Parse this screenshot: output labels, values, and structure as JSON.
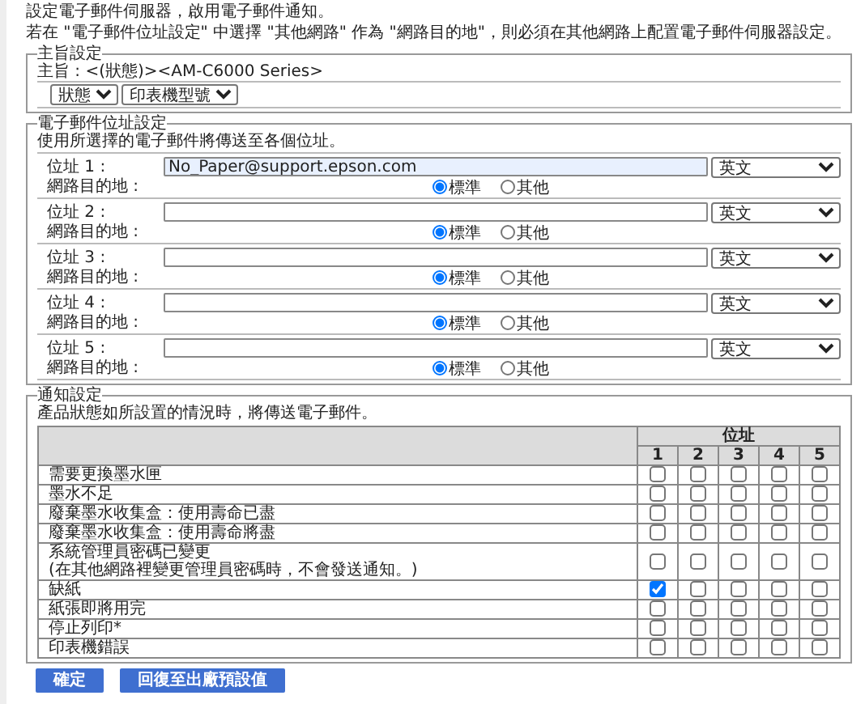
{
  "intro": [
    "設定電子郵件伺服器，啟用電子郵件通知。",
    "若在 \"電子郵件位址設定\" 中選擇 \"其他網路\" 作為 \"網路目的地\"，則必須在其他網路上配置電子郵件伺服器設定。"
  ],
  "subject_settings": {
    "title": "主旨設定",
    "subject": "主旨 : <(狀態)><AM-C6000 Series>",
    "selects": [
      "狀態",
      "印表機型號"
    ]
  },
  "address_settings": {
    "title": "電子郵件位址設定",
    "description": "使用所選擇的電子郵件將傳送至各個位址。",
    "addresses": [
      {
        "label": "位址 1 :",
        "value": "No_Paper@support.epson.com",
        "language": "英文",
        "destination_label": "網路目的地 :",
        "destination": [
          {
            "label": "標準",
            "selected": true
          },
          {
            "label": "其他",
            "selected": false
          }
        ]
      },
      {
        "label": "位址 2 :",
        "language": "英文",
        "destination_label": "網路目的地 :",
        "destination": [
          {
            "label": "標準",
            "selected": true
          },
          {
            "label": "其他",
            "selected": false
          }
        ]
      },
      {
        "label": "位址 3 :",
        "language": "英文",
        "destination_label": "網路目的地 :",
        "destination": [
          {
            "label": "標準",
            "selected": true
          },
          {
            "label": "其他",
            "selected": false
          }
        ]
      },
      {
        "label": "位址 4 :",
        "language": "英文",
        "destination_label": "網路目的地 :",
        "destination": [
          {
            "label": "標準",
            "selected": true
          },
          {
            "label": "其他",
            "selected": false
          }
        ]
      },
      {
        "label": "位址 5 :",
        "language": "英文",
        "destination_label": "網路目的地 :",
        "destination": [
          {
            "label": "標準",
            "selected": true
          },
          {
            "label": "其他",
            "selected": false
          }
        ]
      }
    ]
  },
  "notification_settings": {
    "title": "通知設定",
    "description": "產品狀態如所設置的情況時，將傳送電子郵件。",
    "table": {
      "group_header": "位址",
      "columns": [
        "1",
        "2",
        "3",
        "4",
        "5"
      ],
      "rows": [
        {
          "label": "需要更換墨水匣",
          "checks": [
            false,
            false,
            false,
            false,
            false
          ]
        },
        {
          "label": "墨水不足",
          "checks": [
            false,
            false,
            false,
            false,
            false
          ]
        },
        {
          "label": "廢棄墨水收集盒：使用壽命已盡",
          "checks": [
            false,
            false,
            false,
            false,
            false
          ]
        },
        {
          "label": "廢棄墨水收集盒：使用壽命將盡",
          "checks": [
            false,
            false,
            false,
            false,
            false
          ]
        },
        {
          "label": "系統管理員密碼已變更",
          "note": "(在其他網路裡變更管理員密碼時，不會發送通知。)",
          "checks": [
            false,
            false,
            false,
            false,
            false
          ]
        },
        {
          "label": "缺紙",
          "checks": [
            true,
            false,
            false,
            false,
            false
          ]
        },
        {
          "label": "紙張即將用完",
          "checks": [
            false,
            false,
            false,
            false,
            false
          ]
        },
        {
          "label": "停止列印*",
          "checks": [
            false,
            false,
            false,
            false,
            false
          ]
        },
        {
          "label": "印表機錯誤",
          "checks": [
            false,
            false,
            false,
            false,
            false
          ]
        }
      ]
    }
  },
  "buttons": [
    "確定",
    "回復至出廠預設值"
  ]
}
